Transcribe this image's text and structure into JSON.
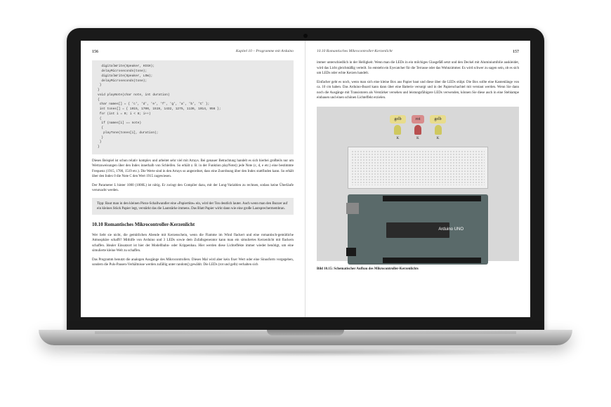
{
  "leftPage": {
    "number": "156",
    "chapter": "Kapitel 10 – Programme mit Arduino",
    "code1": {
      "l1": "  digitalWrite(Speaker, HIGH);",
      "l2": "  delayMicroseconds(tone);",
      "l3": "  digitalWrite(Speaker, LOW);",
      "l4": "  delayMicroseconds(tone);",
      "l5": " }",
      "l6": "}",
      "l7": "",
      "l8": "void playNote(char note, int duration)",
      "l9": "{",
      "l10": " char names[] = { 'c', 'd', 'e', 'f', 'g', 'a', 'b', 'C' };",
      "l11": " int tones[] = { 1915, 1700, 1519, 1432, 1275, 1136, 1014, 956 };",
      "l12": " for (int i = 0; i < 8; i++)",
      "l13": " {",
      "l14": "  if (names[i] == note)",
      "l15": "  {",
      "l16": "   playTone(tones[i], duration);",
      "l17": "  }",
      "l18": " }",
      "l19": "}"
    },
    "para1": "Dieses Beispiel ist schon relativ komplex und arbeitet sehr viel mit Arrays. Bei genauer Betrachtung handelt es sich hierbei großteils nur um Wertzuweisungen über den Index innerhalb von Schleifen. So erhält z. B. in der Funktion playNote() jede Note (c, d, e etc.) eine bestimmte Frequenz (1915, 1700, 1519 etc.). Die Werte sind in den Arrays so angeordnet, dass eine Zuordnung über den Index stattfinden kann. So erhält über den Index 0 die Note C den Wert 1915 zugewiesen.",
    "para2": "Der Parameter L hinter 1000 (1000L) ist nötig. Er zwingt den Compiler dazu, mit der Long-Variablen zu rechnen, sodass keine Überläufe verursacht werden.",
    "tip": "Tipp: Baut man in den kleinen Piezo-Schallwandler eine »Papiertüte« ein, wird der Ton deutlich lauter. Auch wenn man den Buzzer auf ein kleines Stück Papier legt, verstärkt das die Lautstärke immens. Das Blatt Papier wirkt dann wie eine große Lautsprechermembran.",
    "heading": "10.10  Romantisches Mikrocontroller-Kerzenlicht",
    "para3": "Wer liebt sie nicht, die gemütlichen Abende mit Kerzenschein, wenn die Flamme im Wind flackert und eine romantisch-gemütliche Atmosphäre schafft? Mithilfe von Arduino und 3 LEDs sowie dem Zufallsgenerator kann man ein simuliertes Kerzenlicht mit flackern schaffen. Idealer Einsatzort ist hier der Modellbahn- oder Krippenbau. Hier werden diese Lichteffekte immer wieder benötigt, um eine simulierte kleine Welt zu schaffen.",
    "para4": "Das Programm benutzt die analogen Ausgänge des Mikrocontrollers. Dieses Mal wird aber kein fixer Wert oder eine Sinusform vorgegeben, sondern die Puls-Pausen-Verhältnisse werden zufällig unter random() gewählt. Die LEDs (rot und gelb) verhalten sich"
  },
  "rightPage": {
    "number": "157",
    "chapter": "10.10  Romantisches Mikrocontroller-Kerzenlicht",
    "para1": "immer unterschiedlich in der Helligkeit. Wenn man die LEDs in ein milchiges Glasgefäß setzt und den Deckel mit Aluminiumfolie auskleidet, wird das Licht gleichmäßig verteilt. So entsteht ein Eyecatcher für die Terrasse oder das Wohnzimmer. Es wird schwer zu sagen sein, ob es sich um LEDs oder echte Kerzen handelt.",
    "para2": "Einfacher geht es noch, wenn man sich eine kleine Box aus Papier baut und diese über die LEDs stülpt. Die Box sollte eine Kantenlänge von ca. 10 cm haben. Das Arduino-Board kann dann über eine Batterie versorgt und in der Papierschachtel mit verstaut werden. Wenn Sie dann noch die Ausgänge mit Transistoren als Verstärker versehen und leistungsfähigere LEDs verwenden, können Sie diese auch in eine Stehlampe einbauen und einen schönen Lichteffekt erzielen.",
    "labels": {
      "yellow1": "gelb",
      "red": "rot",
      "yellow2": "gelb",
      "k": "K"
    },
    "arduino": "Arduino  UNO",
    "caption": "Bild 10.15: Schematischer Aufbau des Mikrocontroller-Kerzenlichts"
  }
}
